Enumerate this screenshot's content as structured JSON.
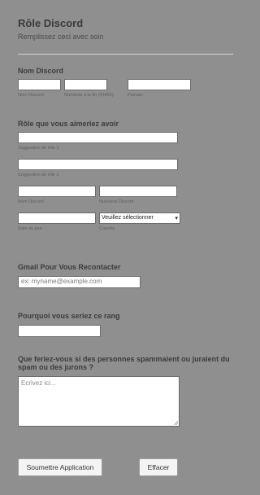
{
  "header": {
    "title": "Rôle Discord",
    "subtitle": "Remplissez ceci avec soin"
  },
  "discord_name": {
    "label": "Nom Discord",
    "sublabels": [
      "Nom Discord",
      "Numéros à la fin (#3456)",
      "Pseudo"
    ]
  },
  "role": {
    "label": "Rôle que vous aimeriez avoir",
    "suggestion_1": "Suggestion de rôle 1",
    "suggestion_2": "Suggestion de rôle 1",
    "name_sublabel": "Nom Discord",
    "number_sublabel": "Numéros Discord",
    "date_sublabel": "Date du jour",
    "country_sublabel": "Country",
    "select_value": "Veuillez sélectionner"
  },
  "gmail": {
    "label": "Gmail Pour Vous Recontacter",
    "placeholder": "ex: myname@example.com"
  },
  "rank": {
    "label": "Pourquoi vous seriez ce rang"
  },
  "spam": {
    "label": "Que feriez-vous si des personnes spammaient ou juraient du spam ou des jurons ?",
    "placeholder": "Ecrivez ici..."
  },
  "buttons": {
    "submit": "Soumettre Application",
    "clear": "Effacer"
  },
  "icons": {
    "select_caret": "chevron-down-icon",
    "textarea_grip": "resize-grip-icon"
  }
}
